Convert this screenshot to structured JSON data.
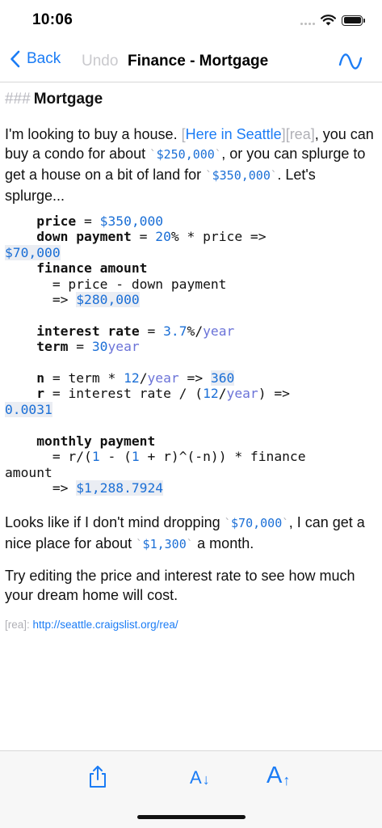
{
  "status_bar": {
    "time": "10:06"
  },
  "nav": {
    "back_label": "Back",
    "undo_label": "Undo",
    "title": "Finance - Mortgage"
  },
  "doc": {
    "heading_marker": "###",
    "heading": "Mortgage",
    "p1": {
      "t1": "I'm looking to buy a house. ",
      "link_open": "[",
      "link_text": "Here in Seattle",
      "link_close": "]",
      "ref": "[rea]",
      "t2": ", you can buy a condo for about ",
      "tick": "`",
      "code_condo": "$250,000",
      "t3": ", or you can splurge to get a house on a bit of land for ",
      "code_house": "$350,000",
      "t4": ". Let's splurge..."
    },
    "code": {
      "price_label": "price",
      "eq": "=",
      "price_value": "$350,000",
      "down_label": "down payment",
      "down_pct": "20",
      "down_rest": "% * price =>",
      "down_result": "$70,000",
      "finance_label": "finance amount",
      "finance_expr": "= price - down payment",
      "arrow": "=>",
      "finance_result": "$280,000",
      "rate_label": "interest rate",
      "rate_value": "3.7",
      "rate_pct_slash": "%/",
      "unit_year": "year",
      "term_label": "term",
      "term_value": "30",
      "n_label": "n",
      "n_expr1": "= term * ",
      "n_12": "12",
      "slash": "/",
      "n_result": "360",
      "r_label": "r",
      "r_expr1": "= interest rate / (",
      "r_expr2": ") =>",
      "r_result": "0.0031",
      "monthly_label": "monthly payment",
      "monthly_expr1": "= r/(",
      "one": "1",
      "monthly_expr2": " - (",
      "monthly_expr3": " + r)^(-n)) * finance",
      "monthly_wrap": "amount",
      "monthly_result": "$1,288.7924"
    },
    "p2": {
      "t1": "Looks like if I don't mind dropping ",
      "code_drop": "$70,000",
      "t2": ", I can get a nice place for about ",
      "code_month": "$1,300",
      "t3": " a month."
    },
    "p3": "Try editing the price and interest rate to see how much your dream home will cost.",
    "ref_line": {
      "label": "[rea]:",
      "url": "http://seattle.craigslist.org/rea/"
    }
  },
  "toolbar": {
    "smaller_letter": "A",
    "smaller_arrow": "↓",
    "larger_letter": "A",
    "larger_arrow": "↑"
  },
  "colors": {
    "accent": "#1b7cf5",
    "code_number": "#1b6fd6",
    "code_unit": "#6b73d8",
    "muted": "#b0b0b6"
  }
}
